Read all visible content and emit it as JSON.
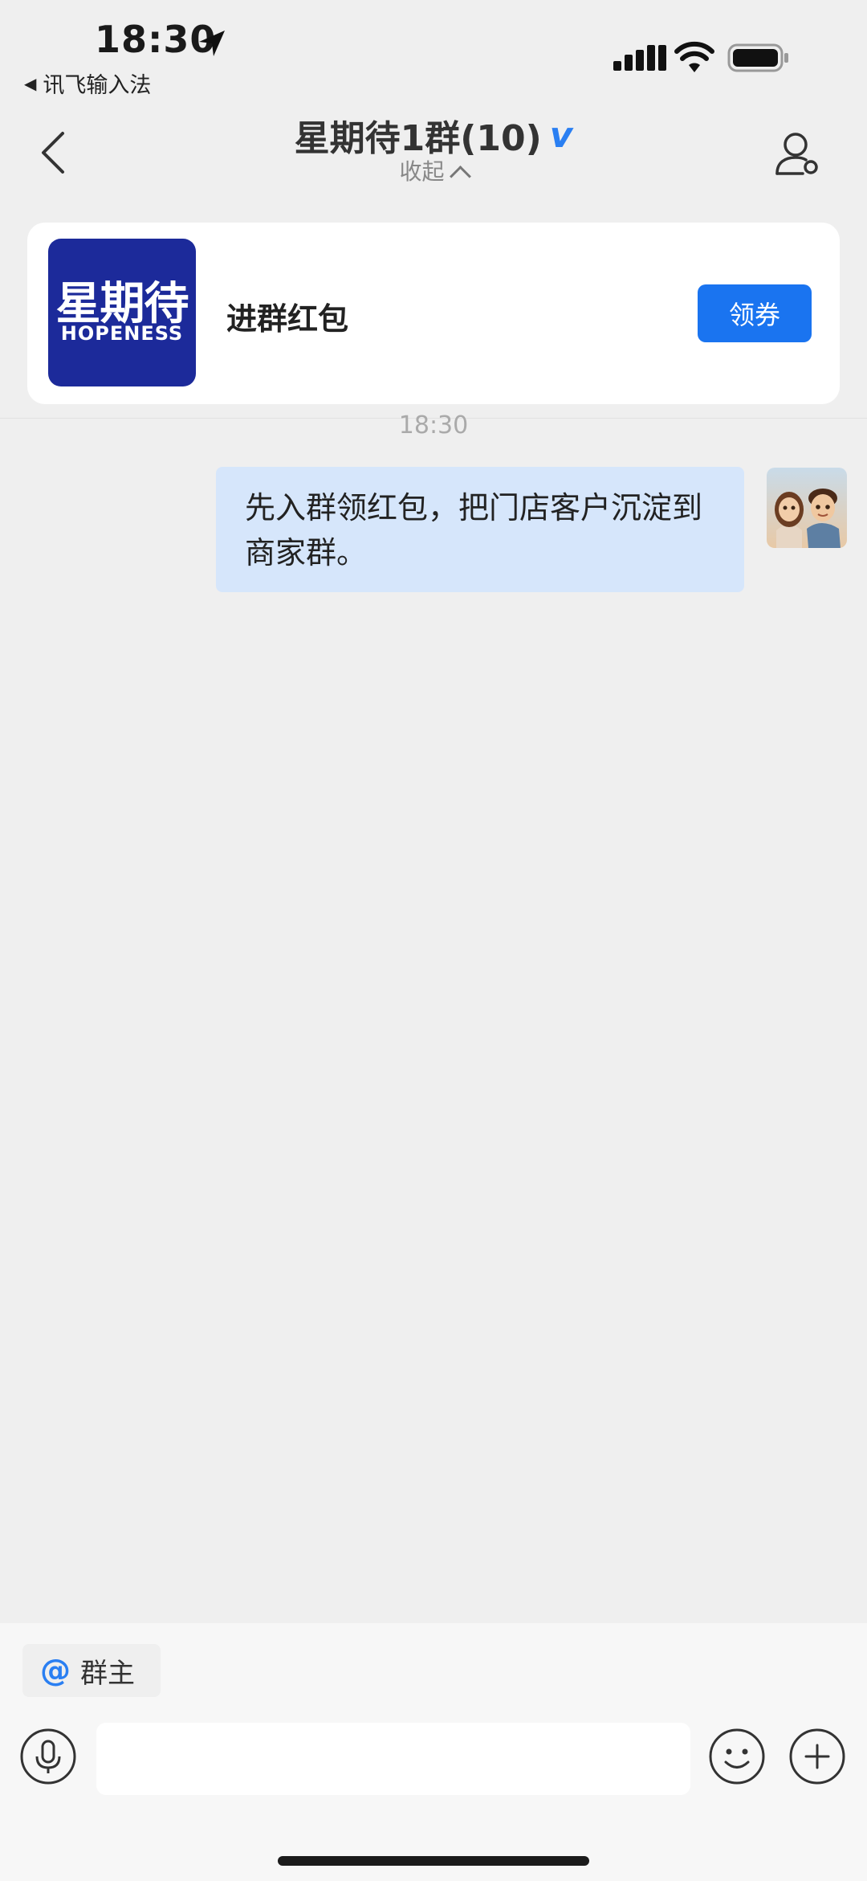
{
  "status_bar": {
    "time": "18:30",
    "back_app": "讯飞输入法",
    "back_arrow": "◀"
  },
  "nav": {
    "title": "星期待1群(10)",
    "verified_mark": "v",
    "collapse_label": "收起",
    "icons": {
      "back": "chevron-left-icon",
      "profile": "group-member-icon"
    }
  },
  "promo": {
    "logo_cn": "星期待",
    "logo_en": "HOPENESS",
    "label": "进群红包",
    "button": "领券"
  },
  "chat": {
    "timestamp": "18:30",
    "messages": [
      {
        "text": "先入群领红包，把门店客户沉淀到商家群。",
        "side": "right"
      }
    ]
  },
  "composer": {
    "mention_at": "@",
    "mention_label": "群主",
    "input_value": "",
    "input_placeholder": ""
  },
  "colors": {
    "accent": "#1a74f0",
    "logo_bg": "#1c2a9a",
    "bubble": "#d6e6fb",
    "background": "#efefef"
  }
}
